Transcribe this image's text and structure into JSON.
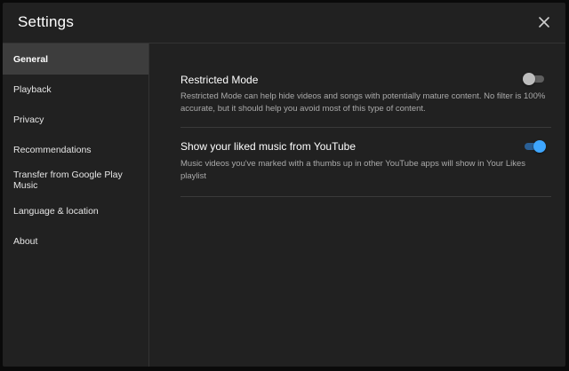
{
  "dialog": {
    "title": "Settings",
    "close_icon": "close-icon"
  },
  "sidebar": {
    "items": [
      {
        "label": "General",
        "active": true
      },
      {
        "label": "Playback",
        "active": false
      },
      {
        "label": "Privacy",
        "active": false
      },
      {
        "label": "Recommendations",
        "active": false
      },
      {
        "label": "Transfer from Google Play Music",
        "active": false
      },
      {
        "label": "Language & location",
        "active": false
      },
      {
        "label": "About",
        "active": false
      }
    ]
  },
  "settings": [
    {
      "title": "Restricted Mode",
      "description": "Restricted Mode can help hide videos and songs with potentially mature content. No filter is 100% accurate, but it should help you avoid most of this type of content.",
      "enabled": false
    },
    {
      "title": "Show your liked music from YouTube",
      "description": "Music videos you've marked with a thumbs up in other YouTube apps will show in Your Likes playlist",
      "enabled": true
    }
  ],
  "colors": {
    "background": "#212121",
    "active_nav": "#3d3d3d",
    "toggle_on": "#3ea6ff",
    "toggle_off": "#bdbdbd"
  }
}
